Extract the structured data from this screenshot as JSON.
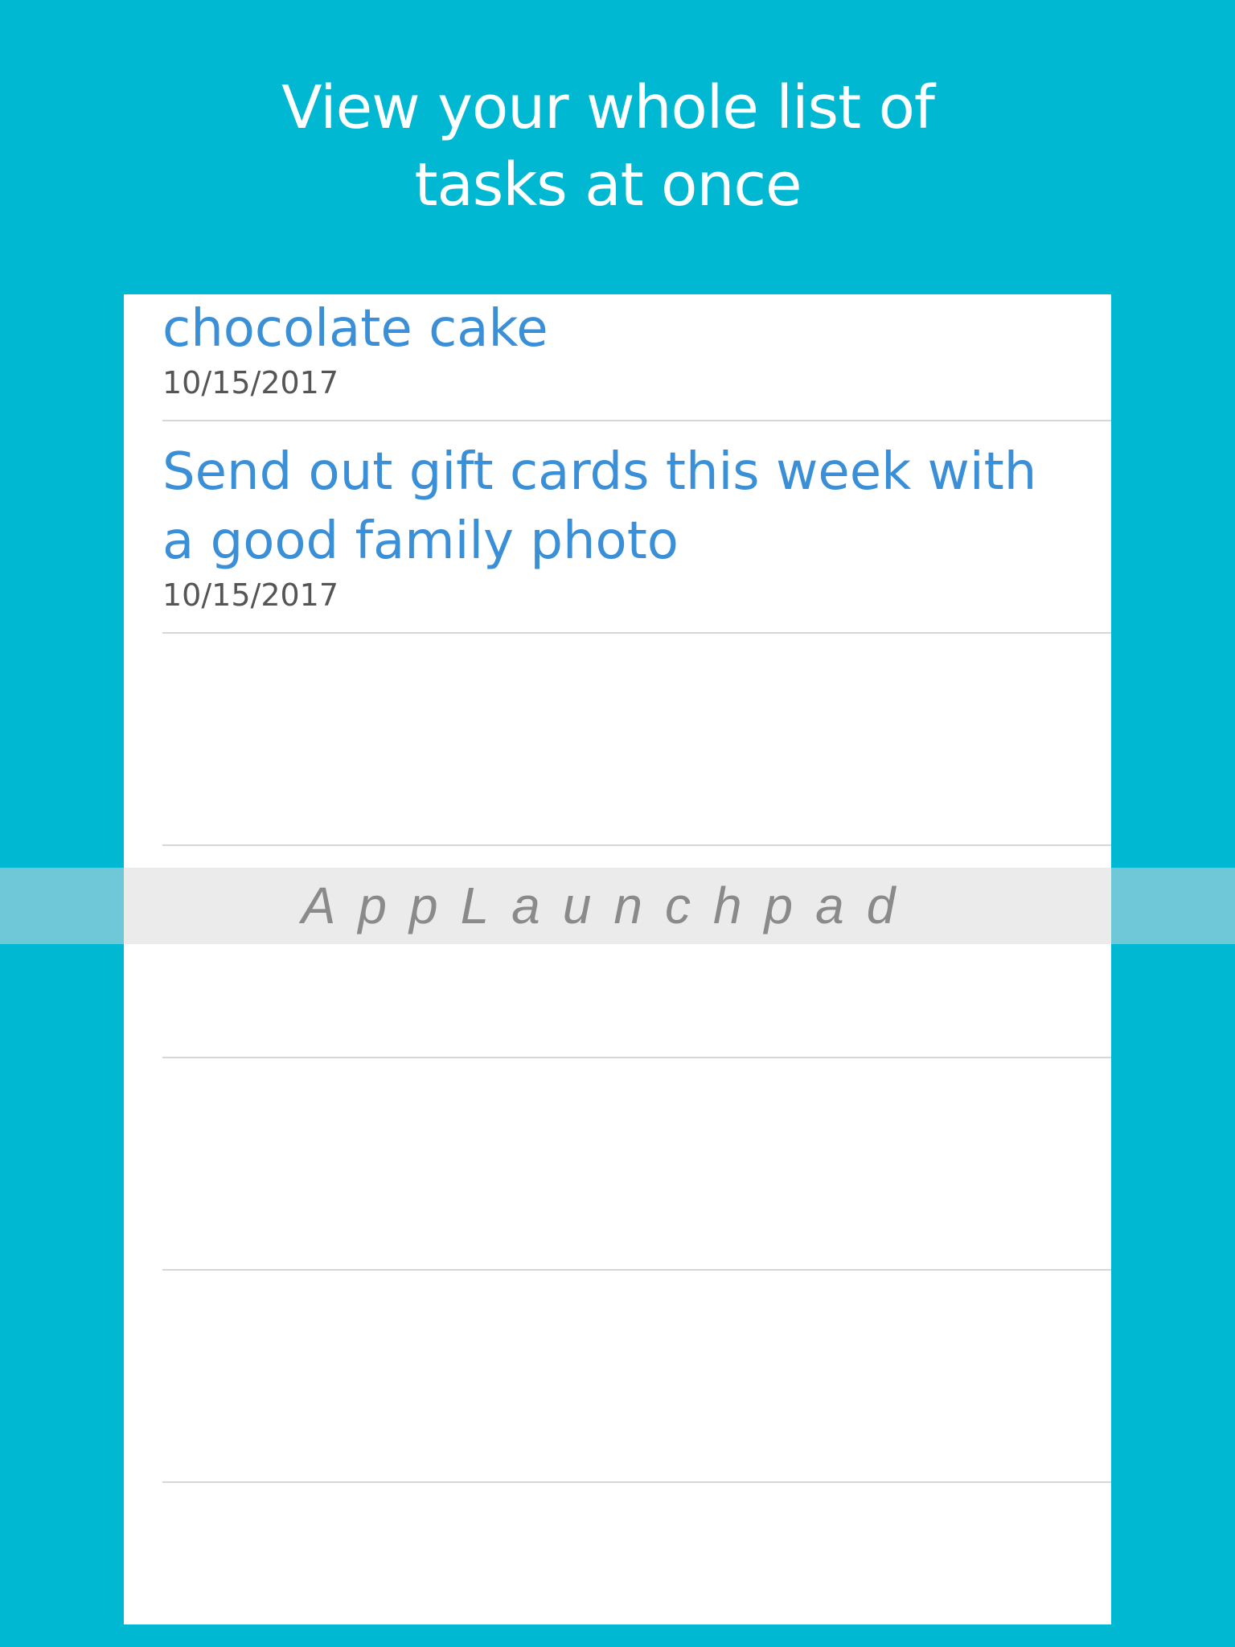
{
  "headline": {
    "line1": "View your whole list of",
    "line2": "tasks at once"
  },
  "tasks": [
    {
      "title_lines": [
        "chocolate cake"
      ],
      "date": "10/15/2017"
    },
    {
      "title_lines": [
        "Send out gift cards this week with",
        "a good family photo"
      ],
      "date": "10/15/2017"
    }
  ],
  "watermark": "AppLaunchpad",
  "colors": {
    "background": "#00b8d1",
    "task_title": "#3a8fd6",
    "task_date": "#555555",
    "divider": "#d6d6d6"
  }
}
